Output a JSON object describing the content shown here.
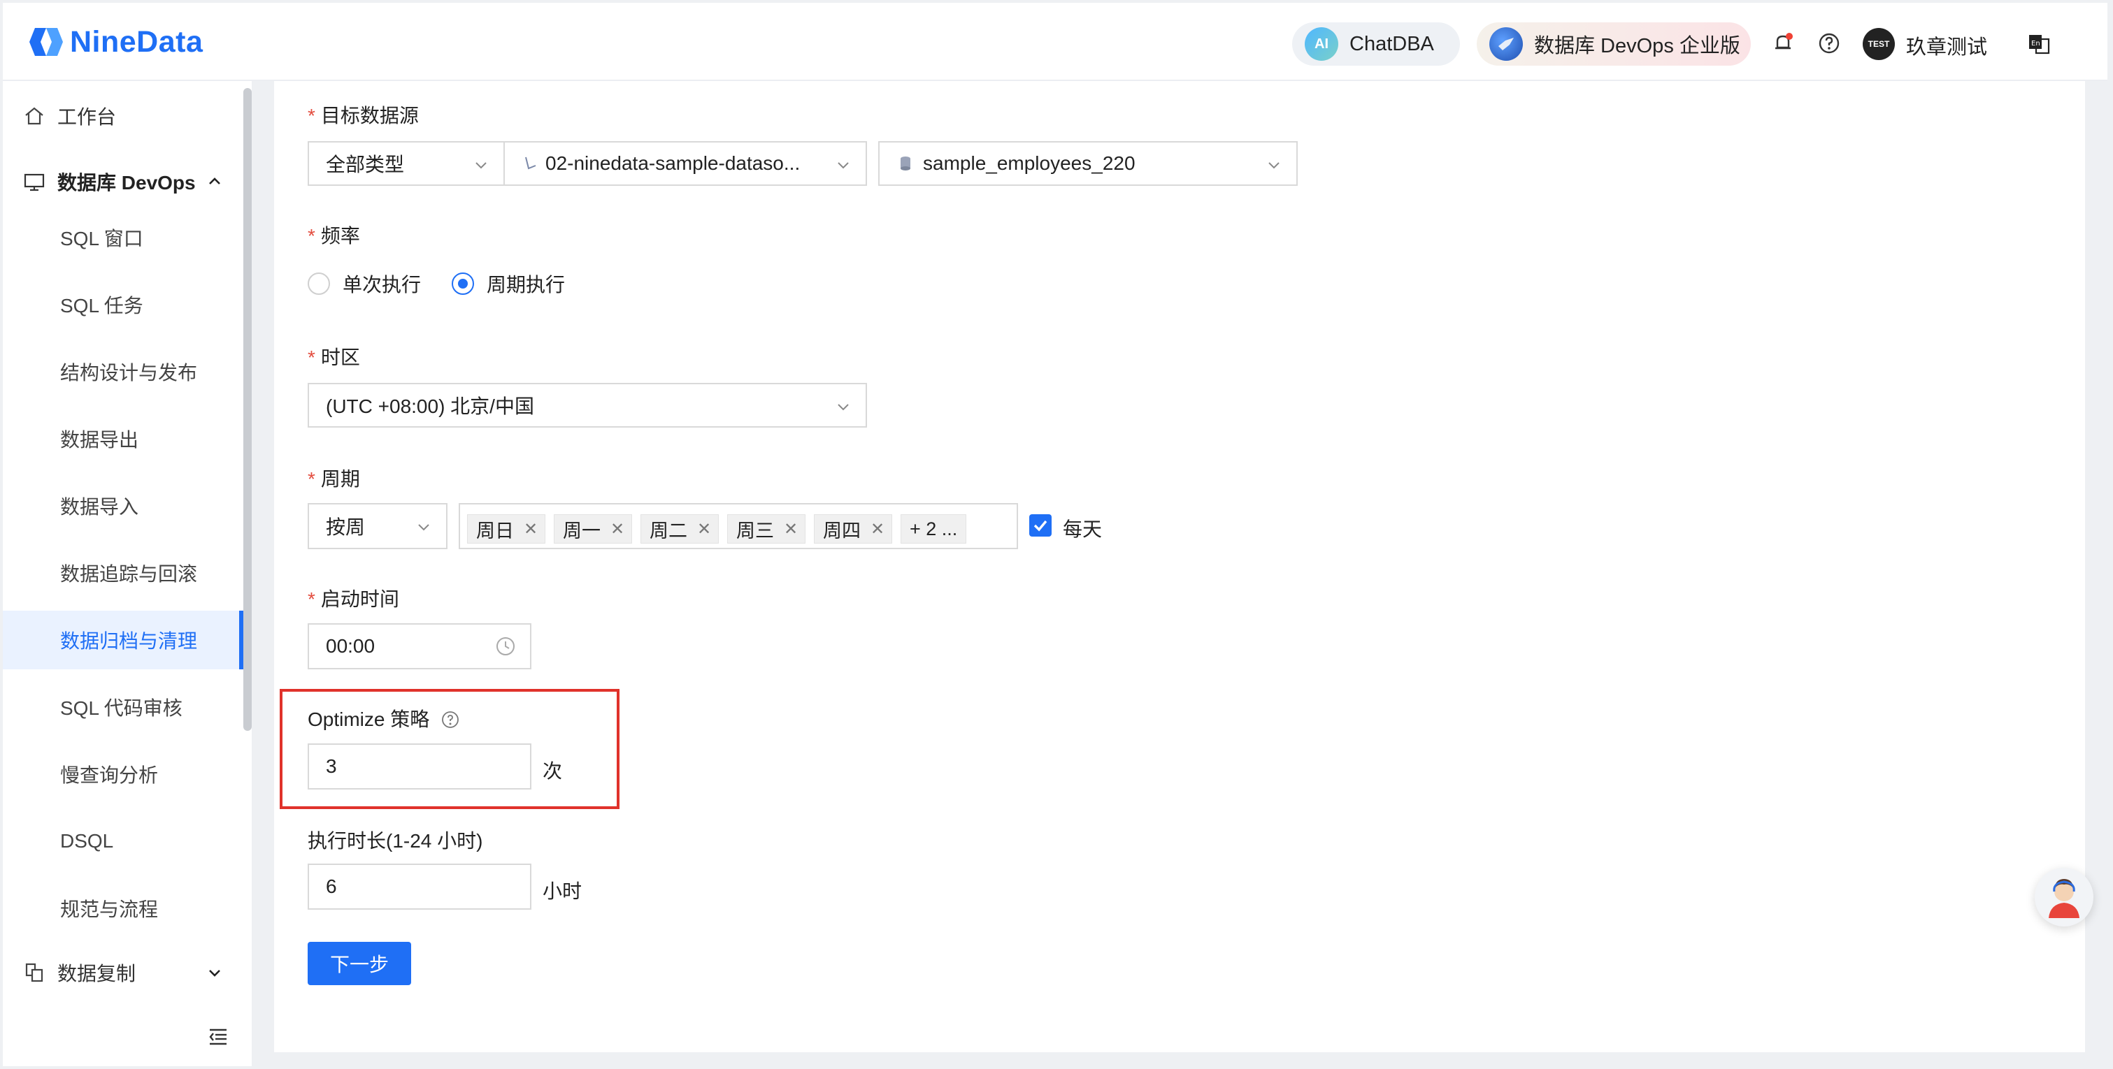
{
  "header": {
    "logo_text": "NineData",
    "chatdba_label": "ChatDBA",
    "devops_label": "数据库 DevOps 企业版",
    "avatar_text": "TEST",
    "username": "玖章测试"
  },
  "sidebar": {
    "workbench": "工作台",
    "devops_group": "数据库 DevOps",
    "items": [
      {
        "label": "SQL 窗口"
      },
      {
        "label": "SQL 任务"
      },
      {
        "label": "结构设计与发布"
      },
      {
        "label": "数据导出"
      },
      {
        "label": "数据导入"
      },
      {
        "label": "数据追踪与回滚"
      },
      {
        "label": "数据归档与清理"
      },
      {
        "label": "SQL 代码审核"
      },
      {
        "label": "慢查询分析"
      },
      {
        "label": "DSQL"
      },
      {
        "label": "规范与流程"
      }
    ],
    "replication_group": "数据复制"
  },
  "form": {
    "target_label": "目标数据源",
    "type_select": "全部类型",
    "datasource_select": "02-ninedata-sample-dataso...",
    "database_select": "sample_employees_220",
    "frequency_label": "频率",
    "radio_once": "单次执行",
    "radio_periodic": "周期执行",
    "timezone_label": "时区",
    "timezone_value": "(UTC +08:00) 北京/中国",
    "period_label": "周期",
    "period_unit": "按周",
    "tags": [
      "周日",
      "周一",
      "周二",
      "周三",
      "周四"
    ],
    "tags_more": "+ 2 ...",
    "everyday_label": "每天",
    "start_time_label": "启动时间",
    "start_time_value": "00:00",
    "optimize_label": "Optimize 策略",
    "optimize_value": "3",
    "optimize_unit": "次",
    "duration_label": "执行时长(1-24 小时)",
    "duration_value": "6",
    "duration_unit": "小时",
    "next_button": "下一步"
  },
  "colors": {
    "accent": "#1f6ff5",
    "highlight_box": "#e0322b",
    "required_mark": "#e34d3f"
  }
}
